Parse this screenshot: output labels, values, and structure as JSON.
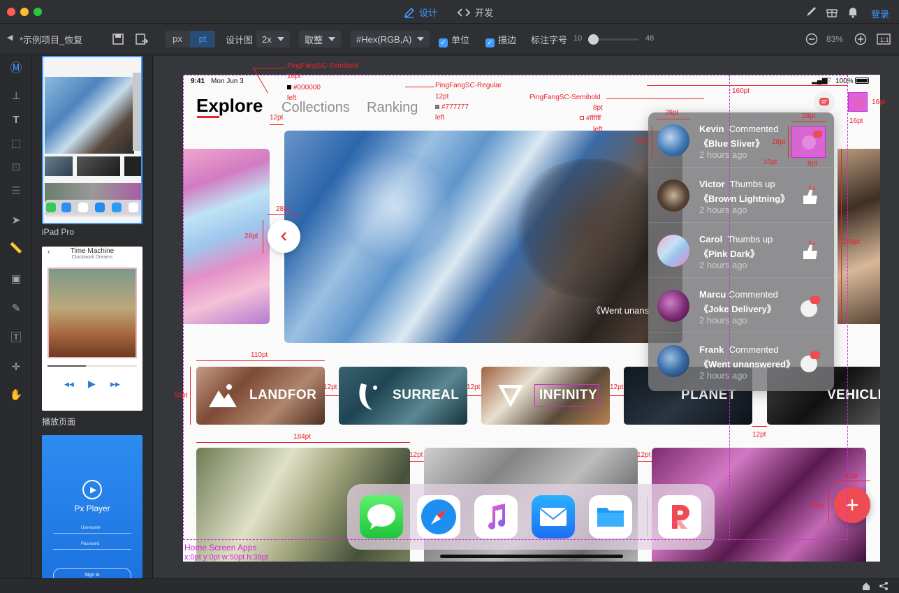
{
  "app": {
    "mode_tabs": [
      {
        "label": "设计",
        "active": true
      },
      {
        "label": "开发",
        "active": false
      }
    ],
    "login_label": "登录",
    "colors": {
      "accent": "#3f9bff",
      "annotation": "#e8242c",
      "selection": "#d22ad8"
    }
  },
  "toolbar": {
    "project_name": "*示例项目_恢复",
    "unit_px": "px",
    "unit_pt": "pt",
    "design_label": "设计图",
    "scale_value": "2x",
    "round_value": "取整",
    "color_format": "#Hex(RGB,A)",
    "unit_check_label": "单位",
    "stroke_check_label": "描边",
    "font_size_label": "标注字号",
    "slider_min": "10",
    "slider_max": "48",
    "zoom_level": "83%"
  },
  "pages": [
    {
      "label": "iPad Pro",
      "selected": true
    },
    {
      "label": "播放页面",
      "selected": false,
      "thumb_title": "Time Machine",
      "thumb_sub": "Clockwork Dreams"
    },
    {
      "label": "",
      "selected": false,
      "thumb_title": "Px Player",
      "thumb_user": "Username",
      "thumb_pass": "Password",
      "thumb_btn": "Sign in"
    }
  ],
  "artboard": {
    "status_time": "9:41",
    "status_date": "Mon Jun 3",
    "battery": "100%",
    "nav": [
      {
        "label": "Explore",
        "active": true
      },
      {
        "label": "Collections",
        "active": false
      },
      {
        "label": "Ranking",
        "active": false
      }
    ],
    "hero_caption": "《Went unans",
    "categories": [
      "LANDFOR",
      "SURREAL",
      "INFINITY",
      "PLANET",
      "VEHICLE"
    ],
    "notifications": [
      {
        "name": "Kevin",
        "action": "Commented",
        "title": "《Blue Sliver》",
        "time": "2 hours ago",
        "icon": "comment-thumb"
      },
      {
        "name": "Victor",
        "action": "Thumbs up",
        "title": "《Brown Lightning》",
        "time": "2 hours ago",
        "icon": "thumbs-up-icon"
      },
      {
        "name": "Carol",
        "action": "Thumbs up",
        "title": "《Pink Dark》",
        "time": "2 hours ago",
        "icon": "thumbs-up-icon"
      },
      {
        "name": "Marcu",
        "action": "Commented",
        "title": "《Joke Delivery》",
        "time": "2 hours ago",
        "icon": "comment-icon"
      },
      {
        "name": "Frank",
        "action": "Commented",
        "title": "《Went unanswered》",
        "time": "2 hours ago",
        "icon": "comment-icon"
      }
    ],
    "dock_apps": [
      "messages-app",
      "safari-app",
      "music-app",
      "mail-app",
      "files-app",
      "pixso-app"
    ],
    "selection_label": "Home Screen Apps",
    "selection_coords": "x:0pt y:0pt w:50pt h:38pt"
  },
  "annotations": {
    "font1": {
      "family": "PingFangSC-Semibold",
      "size": "16pt",
      "color": "#000000",
      "align": "left"
    },
    "font2": {
      "family": "PingFangSC-Regular",
      "size": "12pt",
      "color": "#777777",
      "align": "left"
    },
    "font3": {
      "family": "PingFangSC-Semibold",
      "size": "8pt",
      "color": "#ffffff",
      "align": "left"
    },
    "measures": {
      "m12a": "12pt",
      "m160": "160pt",
      "m16a": "16pt",
      "m16b": "16pt",
      "m28a": "28pt",
      "m28b": "28pt",
      "m28c": "28pt",
      "m28d": "28pt",
      "m28e": "28pt",
      "m28f": "28pt",
      "m10": "10pt",
      "m8": "8pt",
      "m258": "258pt",
      "m110": "110pt",
      "m50": "50pt",
      "m12b": "12pt",
      "m12c": "12pt",
      "m12d": "12pt",
      "m12e": "12pt",
      "m184": "184pt",
      "m12f": "12pt",
      "m12g": "12pt",
      "m32a": "32pt",
      "m32b": "32pt"
    }
  }
}
